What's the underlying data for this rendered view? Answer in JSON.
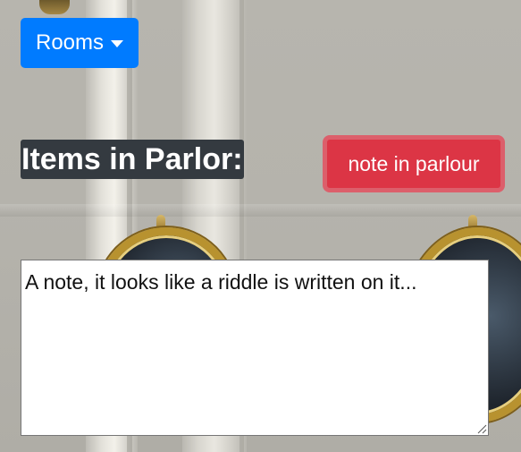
{
  "nav": {
    "rooms_label": "Rooms"
  },
  "room": {
    "heading": "Items in Parlor:",
    "item_button_label": "note in parlour",
    "item_description": "A note, it looks like a riddle is written on it..."
  },
  "colors": {
    "primary": "#007bff",
    "danger": "#dc3545",
    "heading_bg": "#343a40"
  },
  "icons": {
    "rooms_caret": "chevron-down-icon",
    "resize_grip": "resize-handle-icon"
  }
}
